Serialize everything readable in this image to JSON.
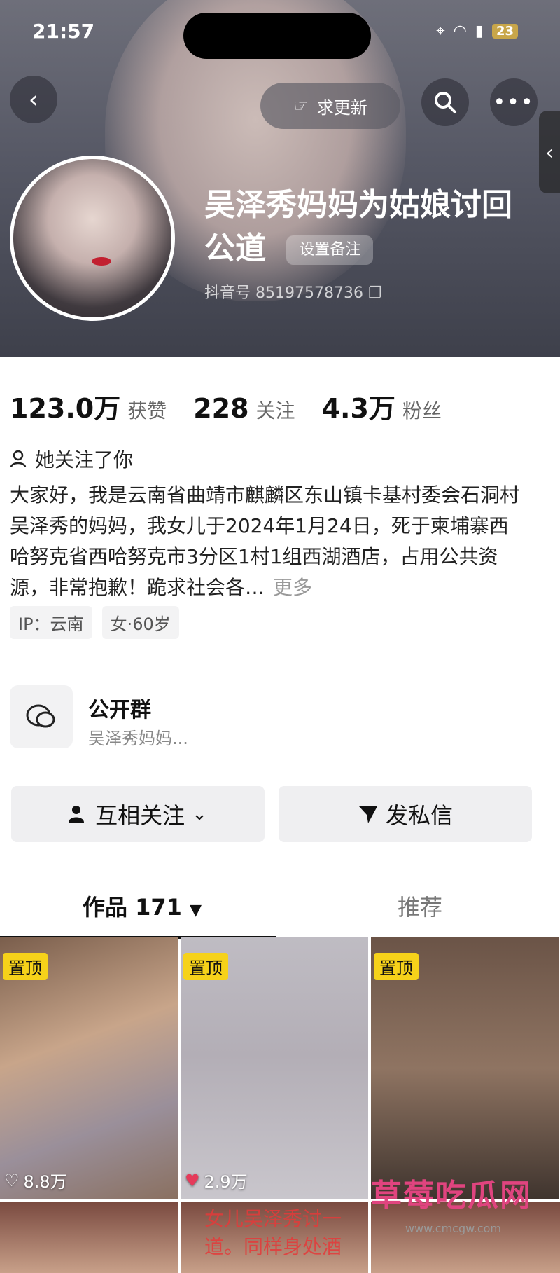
{
  "status_bar": {
    "time": "21:57",
    "battery": "23"
  },
  "header": {
    "back_icon": "back-arrow-icon",
    "update_label": "求更新",
    "search_icon": "search-icon",
    "more_icon": "more-icon",
    "name": "吴泽秀妈妈为姑娘讨回公道",
    "remark_label": "设置备注",
    "douyin_id": "抖音号 85197578736"
  },
  "stats": [
    {
      "number": "123.0万",
      "label": "获赞"
    },
    {
      "number": "228",
      "label": "关注"
    },
    {
      "number": "4.3万",
      "label": "粉丝"
    }
  ],
  "followed_you": "她关注了你",
  "bio": "大家好，我是云南省曲靖市麒麟区东山镇卡基村委会石洞村吴泽秀的妈妈，我女儿于2024年1月24日，死于柬埔寨西哈努克省西哈努克市3分区1村1组西湖酒店，占用公共资源，非常抱歉！跪求社会各…",
  "bio_more": "更多",
  "tags": [
    "IP：云南",
    "女·60岁"
  ],
  "group": {
    "title": "公开群",
    "subtitle": "吴泽秀妈妈..."
  },
  "buttons": {
    "follow": "互相关注",
    "message": "发私信"
  },
  "tabs": {
    "works": "作品 171",
    "recommend": "推荐"
  },
  "thumbnails": [
    {
      "pin": "置顶",
      "likes": "8.8万"
    },
    {
      "pin": "置顶",
      "likes": "2.9万"
    },
    {
      "pin": "置顶",
      "likes": ""
    }
  ],
  "second_row_text": "女儿吴泽秀讨一\n道。同样身处酒",
  "watermark": {
    "main": "草莓吃瓜网",
    "sub": "www.cmcgw.com"
  },
  "colors": {
    "pin": "#f6d21a",
    "heart": "#e53a5a",
    "watermark": "#e0447f"
  }
}
